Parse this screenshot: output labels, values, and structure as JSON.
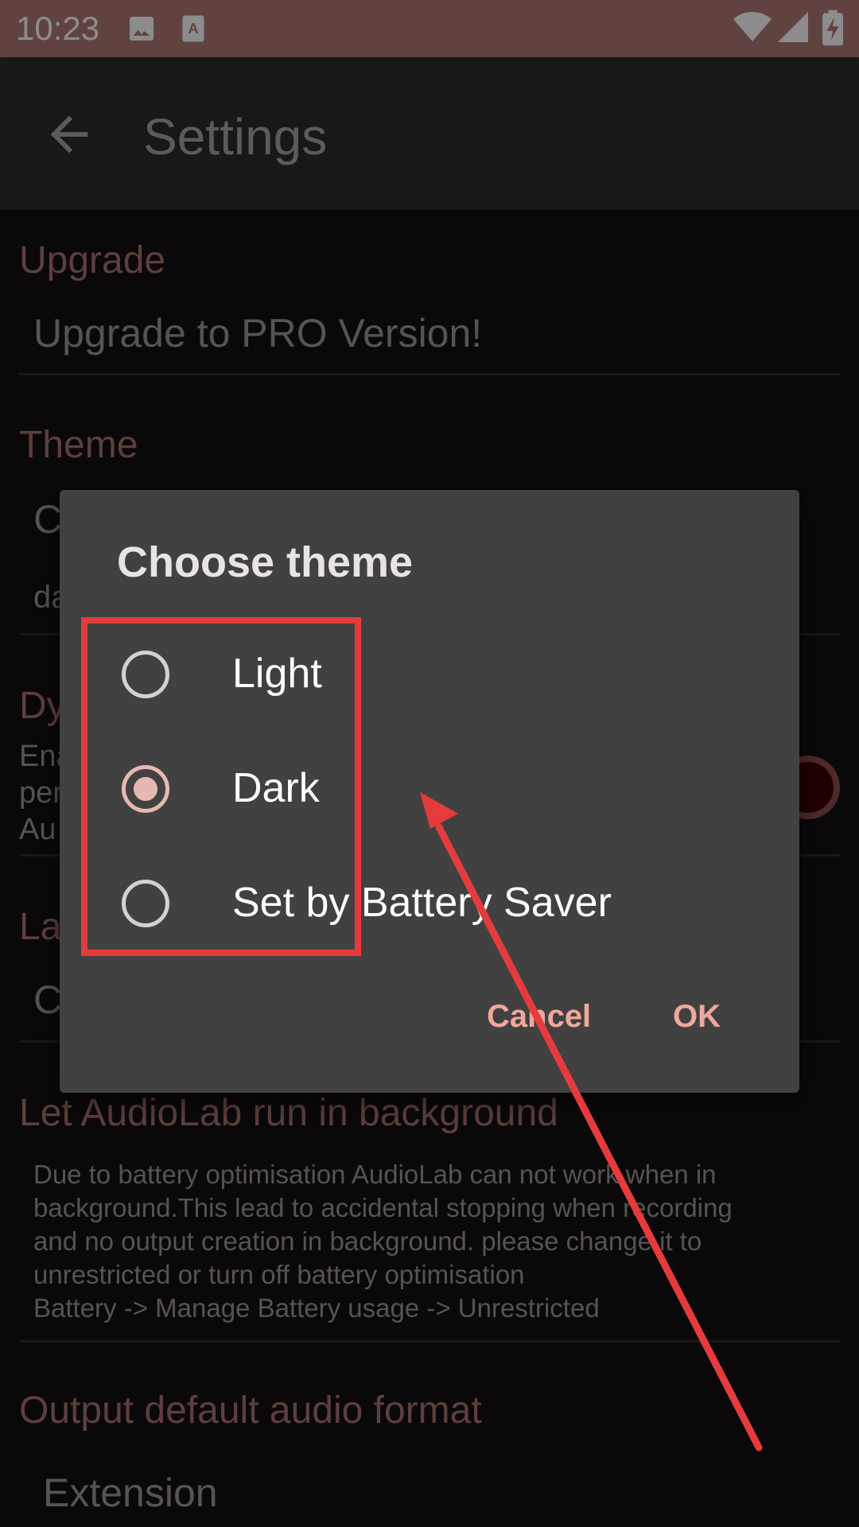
{
  "status_bar": {
    "time": "10:23",
    "icons": [
      "image-icon",
      "text-recognition-icon",
      "wifi-icon",
      "signal-icon",
      "battery-charging-icon"
    ]
  },
  "toolbar": {
    "title": "Settings",
    "back_icon": "arrow-left-icon"
  },
  "settings": {
    "upgrade": {
      "header": "Upgrade",
      "title": "Upgrade to PRO Version!"
    },
    "theme": {
      "header": "Theme",
      "title_partial": "C",
      "summary_partial": "da"
    },
    "dynamic": {
      "header_partial": "Dy",
      "summary_partial": [
        "Ena",
        "per",
        "Au"
      ]
    },
    "language": {
      "header_partial": "La",
      "title_partial": "C"
    },
    "background": {
      "header": "Let AudioLab run in background",
      "summary": [
        "Due to battery optimisation AudioLab can not work when in",
        "background.This lead to accidental stopping when recording",
        "and no output creation in background. please change it to",
        "unrestricted or turn off battery optimisation",
        "Battery -> Manage Battery usage -> Unrestricted"
      ]
    },
    "output": {
      "header": "Output default audio format",
      "title": "Extension"
    }
  },
  "dialog": {
    "title": "Choose theme",
    "options": [
      {
        "label": "Light",
        "checked": false
      },
      {
        "label": "Dark",
        "checked": true
      },
      {
        "label": "Set by Battery Saver",
        "checked": false
      }
    ],
    "cancel_label": "Cancel",
    "ok_label": "OK"
  },
  "colors": {
    "accent": "#f0a79c",
    "section_header": "#a87470",
    "annotation": "#e53b3d",
    "status_bar": "#b07b76"
  }
}
